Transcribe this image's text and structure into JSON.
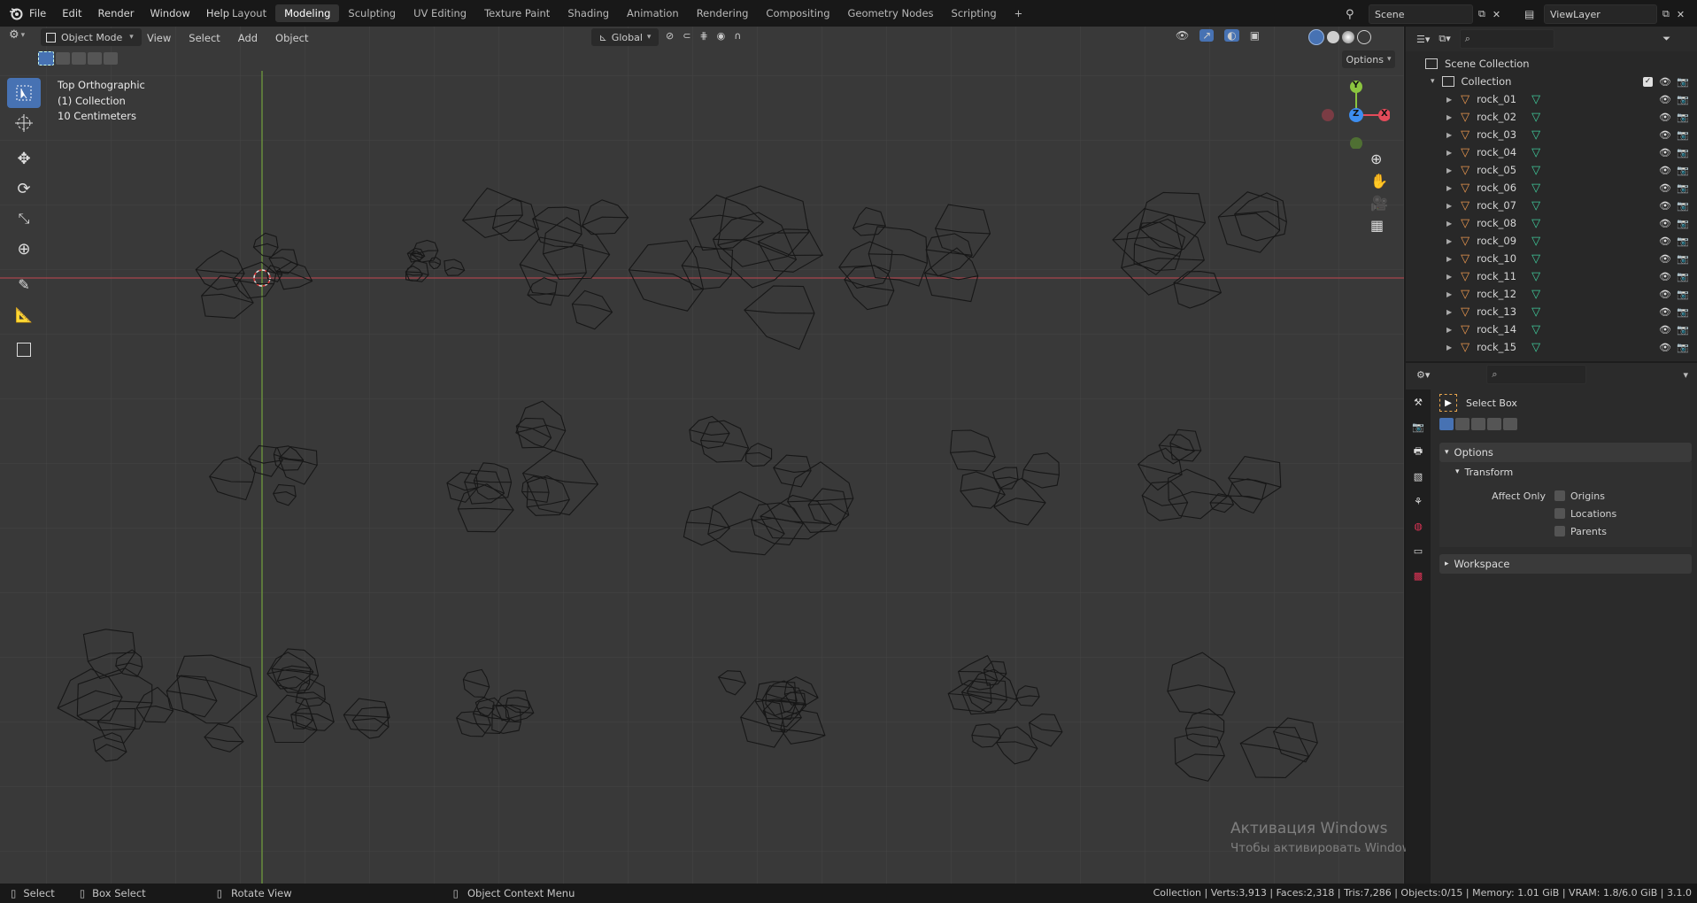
{
  "menu": [
    "File",
    "Edit",
    "Render",
    "Window",
    "Help"
  ],
  "workspaces": [
    {
      "label": "Layout",
      "active": false
    },
    {
      "label": "Modeling",
      "active": true
    },
    {
      "label": "Sculpting",
      "active": false
    },
    {
      "label": "UV Editing",
      "active": false
    },
    {
      "label": "Texture Paint",
      "active": false
    },
    {
      "label": "Shading",
      "active": false
    },
    {
      "label": "Animation",
      "active": false
    },
    {
      "label": "Rendering",
      "active": false
    },
    {
      "label": "Compositing",
      "active": false
    },
    {
      "label": "Geometry Nodes",
      "active": false
    },
    {
      "label": "Scripting",
      "active": false
    }
  ],
  "add_workspace": "+",
  "scene": {
    "name": "Scene"
  },
  "view_layer": {
    "name": "ViewLayer"
  },
  "viewport_header": {
    "mode": "Object Mode",
    "menus": [
      "View",
      "Select",
      "Add",
      "Object"
    ],
    "transform_orientation": "Global",
    "options_label": "Options"
  },
  "viewport_info": {
    "view": "Top Orthographic",
    "collection": "(1) Collection",
    "scale": "10 Centimeters"
  },
  "gizmo": {
    "y": "Y",
    "z": "Z",
    "x": "X"
  },
  "outliner": {
    "scene_collection": "Scene Collection",
    "collection": "Collection",
    "objects": [
      "rock_01",
      "rock_02",
      "rock_03",
      "rock_04",
      "rock_05",
      "rock_06",
      "rock_07",
      "rock_08",
      "rock_09",
      "rock_10",
      "rock_11",
      "rock_12",
      "rock_13",
      "rock_14",
      "rock_15"
    ]
  },
  "properties": {
    "tool_name": "Select Box",
    "options_panel": "Options",
    "transform_subpanel": "Transform",
    "affect_only_label": "Affect Only",
    "checkboxes": [
      "Origins",
      "Locations",
      "Parents"
    ],
    "workspace_panel": "Workspace"
  },
  "watermark": {
    "title": "Активация Windows",
    "subtitle": "Чтобы активировать Windows, перейдите в раздел \"Параметры\"."
  },
  "status": {
    "select": "Select",
    "box_select": "Box Select",
    "rotate_view": "Rotate View",
    "context_menu": "Object Context Menu",
    "stats": "Collection | Verts:3,913 | Faces:2,318 | Tris:7,286 | Objects:0/15 | Memory: 1.01 GiB | VRAM: 1.8/6.0 GiB | 3.1.0"
  },
  "colors": {
    "accent": "#4772b3",
    "x_axis": "#e44b5a",
    "y_axis": "#8bc53f",
    "z_axis": "#3d8ef0",
    "object_icon": "#e8964e",
    "mesh_icon": "#3fc99a"
  }
}
